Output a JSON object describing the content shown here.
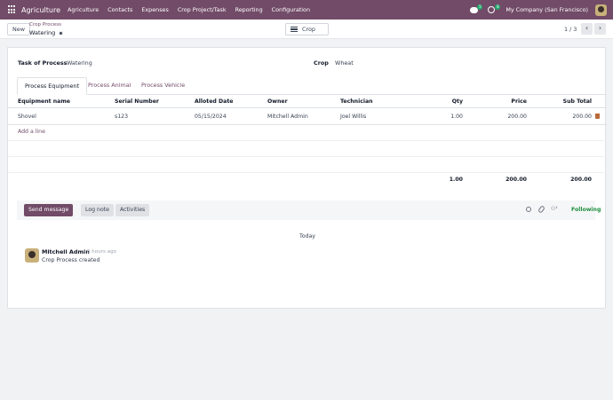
{
  "navbar": {
    "app_name": "Agriculture",
    "menu": [
      "Agriculture",
      "Contacts",
      "Expenses",
      "Crop Project/Task",
      "Reporting",
      "Configuration"
    ],
    "chat_badge": "5",
    "activity_badge": "8",
    "company": "My Company (San Francisco)"
  },
  "control": {
    "new_label": "New",
    "breadcrumb": "Crop Process",
    "record_title": "Watering",
    "crop_button": "Crop",
    "pager": "1 / 3"
  },
  "form": {
    "task_label": "Task of Process",
    "task_value": "Watering",
    "crop_label": "Crop",
    "crop_value": "Wheat",
    "tabs": [
      "Process Equipment",
      "Process Animal",
      "Process Vehicle"
    ],
    "columns": [
      "Equipment name",
      "Serial Number",
      "Alloted Date",
      "Owner",
      "Technician",
      "Qty",
      "Price",
      "Sub Total"
    ],
    "rows": [
      [
        "Shovel",
        "s123",
        "05/15/2024",
        "Mitchell Admin",
        "Joel Willis",
        "1.00",
        "200.00",
        "200.00"
      ]
    ],
    "add_line": "Add a line",
    "totals": {
      "qty": "1.00",
      "price": "200.00",
      "subtotal": "200.00"
    }
  },
  "chatter": {
    "send_message": "Send message",
    "log_note": "Log note",
    "activities": "Activities",
    "following": "Following",
    "day_separator": "Today",
    "message": {
      "author": "Mitchell Admin",
      "time": "- 3 hours ago",
      "body": "Crop Process created"
    }
  }
}
